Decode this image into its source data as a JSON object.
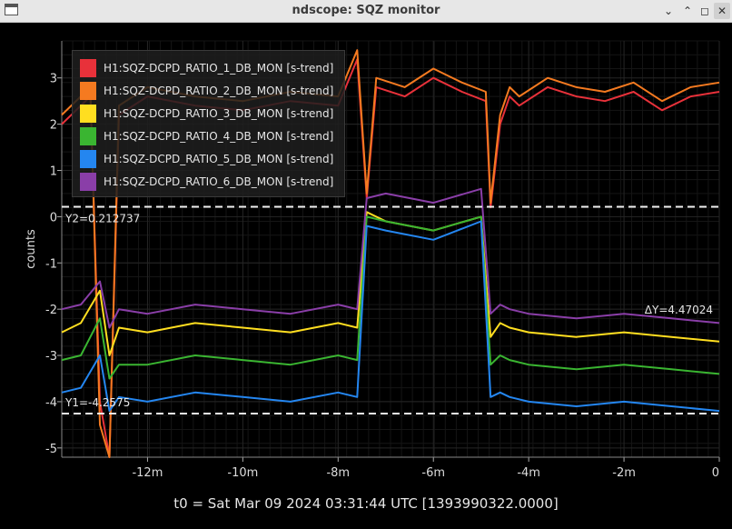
{
  "window": {
    "title": "ndscope: SQZ monitor"
  },
  "chart_data": {
    "type": "line",
    "ylabel": "counts",
    "xlabel": "",
    "xlim": [
      -13.8,
      0
    ],
    "ylim": [
      -5.2,
      3.8
    ],
    "x_ticks": [
      -12,
      -10,
      -8,
      -6,
      -4,
      -2,
      0
    ],
    "x_tick_labels": [
      "-12m",
      "-10m",
      "-8m",
      "-6m",
      "-4m",
      "-2m",
      "0"
    ],
    "y_ticks": [
      3,
      2,
      1,
      0,
      -1,
      -2,
      -3,
      -4,
      -5
    ],
    "y_tick_labels": [
      "3",
      "2",
      "1",
      "0",
      "-1",
      "-2",
      "-3",
      "-4",
      "-5"
    ],
    "grid": true,
    "legend_position": "top-left",
    "series": [
      {
        "name": "H1:SQZ-DCPD_RATIO_1_DB_MON [s-trend]",
        "color": "#e8313a",
        "x": [
          -13.8,
          -13.2,
          -13.0,
          -12.8,
          -12.6,
          -12.0,
          -11.0,
          -10.0,
          -9.0,
          -8.0,
          -7.6,
          -7.4,
          -7.2,
          -6.6,
          -6.0,
          -5.4,
          -4.9,
          -4.8,
          -4.6,
          -4.4,
          -4.2,
          -3.6,
          -3.0,
          -2.4,
          -1.8,
          -1.2,
          -0.6,
          0
        ],
        "y": [
          2.0,
          2.6,
          -4.0,
          -5.2,
          2.2,
          2.6,
          2.4,
          2.3,
          2.5,
          2.4,
          3.4,
          0.4,
          2.8,
          2.6,
          3.0,
          2.7,
          2.5,
          0.2,
          2.0,
          2.6,
          2.4,
          2.8,
          2.6,
          2.5,
          2.7,
          2.3,
          2.6,
          2.7
        ]
      },
      {
        "name": "H1:SQZ-DCPD_RATIO_2_DB_MON [s-trend]",
        "color": "#f57a20",
        "x": [
          -13.8,
          -13.2,
          -13.0,
          -12.8,
          -12.6,
          -12.0,
          -11.0,
          -10.0,
          -9.0,
          -8.0,
          -7.6,
          -7.4,
          -7.2,
          -6.6,
          -6.0,
          -5.4,
          -4.9,
          -4.8,
          -4.6,
          -4.4,
          -4.2,
          -3.6,
          -3.0,
          -2.4,
          -1.8,
          -1.2,
          -0.6,
          0
        ],
        "y": [
          2.2,
          2.8,
          -4.5,
          -5.2,
          2.4,
          2.8,
          2.6,
          2.5,
          2.7,
          2.6,
          3.6,
          0.5,
          3.0,
          2.8,
          3.2,
          2.9,
          2.7,
          0.3,
          2.2,
          2.8,
          2.6,
          3.0,
          2.8,
          2.7,
          2.9,
          2.5,
          2.8,
          2.9
        ]
      },
      {
        "name": "H1:SQZ-DCPD_RATIO_3_DB_MON [s-trend]",
        "color": "#ffde20",
        "x": [
          -13.8,
          -13.4,
          -13.0,
          -12.8,
          -12.6,
          -12.0,
          -11.0,
          -10.0,
          -9.0,
          -8.0,
          -7.6,
          -7.4,
          -7.0,
          -6.0,
          -5.0,
          -4.8,
          -4.6,
          -4.4,
          -4.0,
          -3.0,
          -2.0,
          -1.0,
          0
        ],
        "y": [
          -2.5,
          -2.3,
          -1.6,
          -3.0,
          -2.4,
          -2.5,
          -2.3,
          -2.4,
          -2.5,
          -2.3,
          -2.4,
          0.1,
          -0.1,
          -0.3,
          0.0,
          -2.6,
          -2.3,
          -2.4,
          -2.5,
          -2.6,
          -2.5,
          -2.6,
          -2.7
        ]
      },
      {
        "name": "H1:SQZ-DCPD_RATIO_4_DB_MON [s-trend]",
        "color": "#3ab531",
        "x": [
          -13.8,
          -13.4,
          -13.0,
          -12.8,
          -12.6,
          -12.0,
          -11.0,
          -10.0,
          -9.0,
          -8.0,
          -7.6,
          -7.4,
          -7.0,
          -6.0,
          -5.0,
          -4.8,
          -4.6,
          -4.4,
          -4.0,
          -3.0,
          -2.0,
          -1.0,
          0
        ],
        "y": [
          -3.1,
          -3.0,
          -2.2,
          -3.5,
          -3.2,
          -3.2,
          -3.0,
          -3.1,
          -3.2,
          -3.0,
          -3.1,
          0.0,
          -0.1,
          -0.3,
          0.0,
          -3.2,
          -3.0,
          -3.1,
          -3.2,
          -3.3,
          -3.2,
          -3.3,
          -3.4
        ]
      },
      {
        "name": "H1:SQZ-DCPD_RATIO_5_DB_MON [s-trend]",
        "color": "#2486f0",
        "x": [
          -13.8,
          -13.4,
          -13.0,
          -12.8,
          -12.6,
          -12.0,
          -11.0,
          -10.0,
          -9.0,
          -8.0,
          -7.6,
          -7.4,
          -7.0,
          -6.0,
          -5.0,
          -4.8,
          -4.6,
          -4.4,
          -4.0,
          -3.0,
          -2.0,
          -1.0,
          0
        ],
        "y": [
          -3.8,
          -3.7,
          -3.0,
          -4.2,
          -3.9,
          -4.0,
          -3.8,
          -3.9,
          -4.0,
          -3.8,
          -3.9,
          -0.2,
          -0.3,
          -0.5,
          -0.1,
          -3.9,
          -3.8,
          -3.9,
          -4.0,
          -4.1,
          -4.0,
          -4.1,
          -4.2
        ]
      },
      {
        "name": "H1:SQZ-DCPD_RATIO_6_DB_MON [s-trend]",
        "color": "#8a3ea8",
        "x": [
          -13.8,
          -13.4,
          -13.0,
          -12.8,
          -12.6,
          -12.0,
          -11.0,
          -10.0,
          -9.0,
          -8.0,
          -7.6,
          -7.4,
          -7.0,
          -6.0,
          -5.0,
          -4.8,
          -4.6,
          -4.4,
          -4.0,
          -3.0,
          -2.0,
          -1.0,
          0
        ],
        "y": [
          -2.0,
          -1.9,
          -1.4,
          -2.4,
          -2.0,
          -2.1,
          -1.9,
          -2.0,
          -2.1,
          -1.9,
          -2.0,
          0.4,
          0.5,
          0.3,
          0.6,
          -2.1,
          -1.9,
          -2.0,
          -2.1,
          -2.2,
          -2.1,
          -2.2,
          -2.3
        ]
      }
    ],
    "cursors": {
      "y1": {
        "value": -4.2575,
        "label": "Y1=-4.2575"
      },
      "y2": {
        "value": 0.212737,
        "label": "Y2=0.212737"
      },
      "delta": {
        "label": "ΔY=4.47024"
      }
    },
    "footer": "t0 = Sat Mar 09 2024 03:31:44 UTC [1393990322.0000]"
  }
}
